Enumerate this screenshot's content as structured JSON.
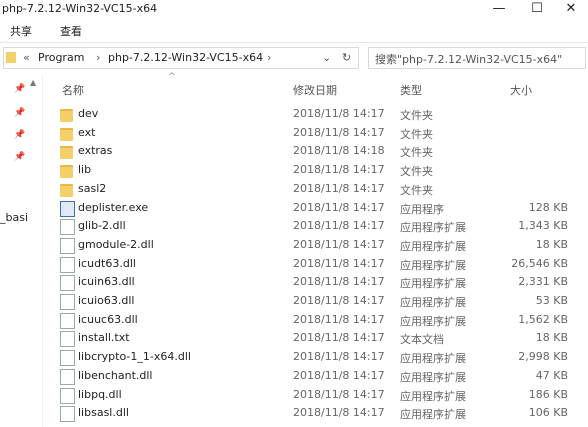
{
  "window": {
    "title": "php-7.2.12-Win32-VC15-x64"
  },
  "ribbon": {
    "tabs": [
      "共享",
      "查看"
    ]
  },
  "address": {
    "crumbs": [
      "«",
      "Program",
      "›",
      "php-7.2.12-Win32-VC15-x64",
      "›"
    ],
    "search_placeholder": "搜索\"php-7.2.12-Win32-VC15-x64\""
  },
  "nav": {
    "partial_label": "_basi"
  },
  "columns": {
    "name": "名称",
    "date": "修改日期",
    "type": "类型",
    "size": "大小"
  },
  "files": [
    {
      "name": "dev",
      "date": "2018/11/8 14:17",
      "type": "文件夹",
      "size": "",
      "icon": "folder-icon"
    },
    {
      "name": "ext",
      "date": "2018/11/8 14:17",
      "type": "文件夹",
      "size": "",
      "icon": "folder-icon"
    },
    {
      "name": "extras",
      "date": "2018/11/8 14:18",
      "type": "文件夹",
      "size": "",
      "icon": "folder-icon"
    },
    {
      "name": "lib",
      "date": "2018/11/8 14:17",
      "type": "文件夹",
      "size": "",
      "icon": "folder-icon"
    },
    {
      "name": "sasl2",
      "date": "2018/11/8 14:17",
      "type": "文件夹",
      "size": "",
      "icon": "folder-icon"
    },
    {
      "name": "deplister.exe",
      "date": "2018/11/8 14:17",
      "type": "应用程序",
      "size": "128 KB",
      "icon": "exe-icon"
    },
    {
      "name": "glib-2.dll",
      "date": "2018/11/8 14:17",
      "type": "应用程序扩展",
      "size": "1,343 KB",
      "icon": "file-icon"
    },
    {
      "name": "gmodule-2.dll",
      "date": "2018/11/8 14:17",
      "type": "应用程序扩展",
      "size": "18 KB",
      "icon": "file-icon"
    },
    {
      "name": "icudt63.dll",
      "date": "2018/11/8 14:17",
      "type": "应用程序扩展",
      "size": "26,546 KB",
      "icon": "file-icon"
    },
    {
      "name": "icuin63.dll",
      "date": "2018/11/8 14:17",
      "type": "应用程序扩展",
      "size": "2,331 KB",
      "icon": "file-icon"
    },
    {
      "name": "icuio63.dll",
      "date": "2018/11/8 14:17",
      "type": "应用程序扩展",
      "size": "53 KB",
      "icon": "file-icon"
    },
    {
      "name": "icuuc63.dll",
      "date": "2018/11/8 14:17",
      "type": "应用程序扩展",
      "size": "1,562 KB",
      "icon": "file-icon"
    },
    {
      "name": "install.txt",
      "date": "2018/11/8 14:17",
      "type": "文本文档",
      "size": "18 KB",
      "icon": "file-icon"
    },
    {
      "name": "libcrypto-1_1-x64.dll",
      "date": "2018/11/8 14:17",
      "type": "应用程序扩展",
      "size": "2,998 KB",
      "icon": "file-icon"
    },
    {
      "name": "libenchant.dll",
      "date": "2018/11/8 14:17",
      "type": "应用程序扩展",
      "size": "47 KB",
      "icon": "file-icon"
    },
    {
      "name": "libpq.dll",
      "date": "2018/11/8 14:17",
      "type": "应用程序扩展",
      "size": "186 KB",
      "icon": "file-icon"
    },
    {
      "name": "libsasl.dll",
      "date": "2018/11/8 14:17",
      "type": "应用程序扩展",
      "size": "106 KB",
      "icon": "file-icon"
    }
  ]
}
